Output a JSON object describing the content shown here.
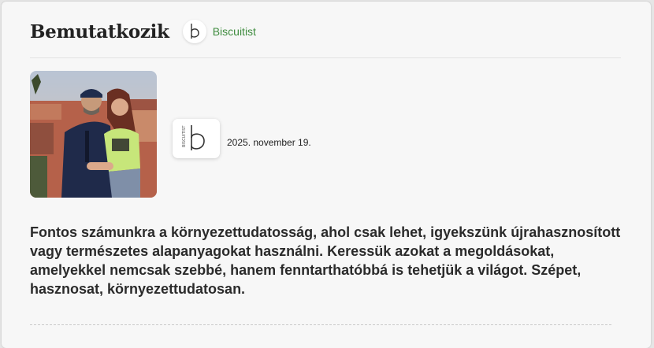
{
  "section": {
    "title": "Bemutatkozik",
    "brand_name": "Biscuitist",
    "brand_icon": "biscuitist-logo-icon"
  },
  "post": {
    "photo": "couple-photo",
    "logo_icon": "biscuitist-logo-icon",
    "logo_wordmark": "BISCUITIST",
    "date": "2025. november 19.",
    "description": "Fontos számunkra a környezettudatosság, ahol csak lehet, igyekszünk újrahasznosított vagy természetes alapanyagokat használni. Keressük azokat a megoldásokat, amelyekkel nemcsak szebbé, hanem fenntarthatóbbá is tehetjük a világot. Szépet, hasznosat, környezettudatosan."
  },
  "colors": {
    "brand_green": "#3f8c3f",
    "card_bg": "#f7f7f7",
    "text": "#2b2b2b"
  }
}
